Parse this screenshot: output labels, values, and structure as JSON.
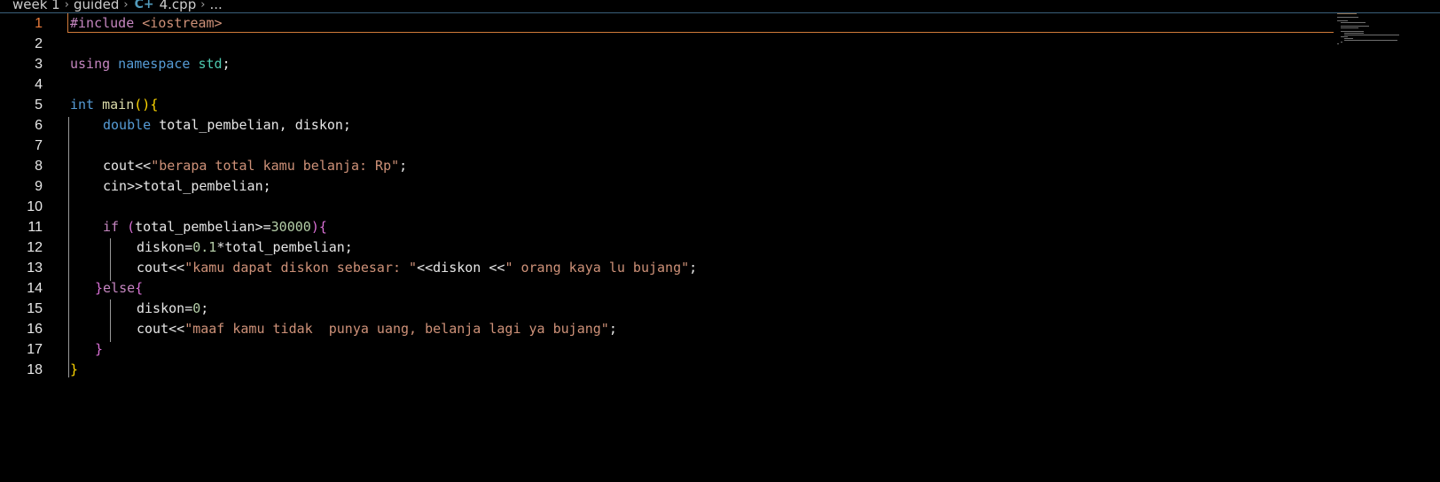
{
  "breadcrumb": {
    "items": [
      "week 1",
      "guided",
      "4.cpp",
      "..."
    ],
    "file_icon": "cpp-file-icon",
    "separator": "chevron-right-icon"
  },
  "editor": {
    "active_line": 1,
    "lines": [
      {
        "n": "1"
      },
      {
        "n": "2"
      },
      {
        "n": "3"
      },
      {
        "n": "4"
      },
      {
        "n": "5"
      },
      {
        "n": "6"
      },
      {
        "n": "7"
      },
      {
        "n": "8"
      },
      {
        "n": "9"
      },
      {
        "n": "10"
      },
      {
        "n": "11"
      },
      {
        "n": "12"
      },
      {
        "n": "13"
      },
      {
        "n": "14"
      },
      {
        "n": "15"
      },
      {
        "n": "16"
      },
      {
        "n": "17"
      },
      {
        "n": "18"
      }
    ],
    "tokens": {
      "l1_include": "#include",
      "l1_header": " <iostream>",
      "l3_using": "using",
      "l3_namespace": " namespace",
      "l3_std": " std",
      "l3_semi": ";",
      "l5_int": "int",
      "l5_main": " main",
      "l5_paren": "()",
      "l5_brace": "{",
      "l6_double": "double",
      "l6_rest": " total_pembelian, diskon;",
      "l8_cout": "cout<<",
      "l8_str": "\"berapa total kamu belanja: Rp\"",
      "l8_semi": ";",
      "l9_text": "cin>>total_pembelian;",
      "l11_if": "if",
      "l11_open": " (",
      "l11_var": "total_pembelian",
      "l11_op": ">=",
      "l11_num": "30000",
      "l11_close": ")",
      "l11_brace": "{",
      "l12_var": "diskon",
      "l12_eq": "=",
      "l12_num": "0.1",
      "l12_rest": "*total_pembelian;",
      "l13_cout": "cout<<",
      "l13_str1": "\"kamu dapat diskon sebesar: \"",
      "l13_mid": "<<diskon <<",
      "l13_str2": "\" orang kaya lu bujang\"",
      "l13_semi": ";",
      "l14_close": "}",
      "l14_else": "else",
      "l14_open": "{",
      "l15_var": "diskon",
      "l15_eq": "=",
      "l15_num": "0",
      "l15_semi": ";",
      "l16_cout": "cout<<",
      "l16_str": "\"maaf kamu tidak  punya uang, belanja lagi ya bujang\"",
      "l16_semi": ";",
      "l17_close": "}",
      "l18_close": "}"
    }
  },
  "colors": {
    "background": "#000000",
    "active_line_number": "#e87a3a",
    "active_line_border": "#d07a3a",
    "string": "#ce9178",
    "keyword": "#569cd6",
    "control": "#c586c0",
    "type": "#4ec9b0",
    "number": "#b5cea8"
  }
}
